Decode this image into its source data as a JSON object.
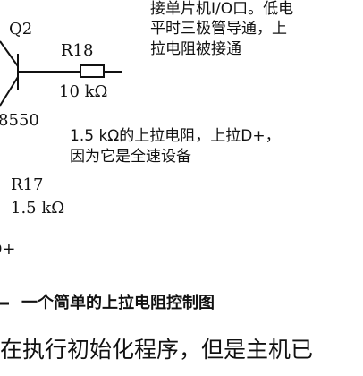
{
  "figure": {
    "labels": {
      "transistor": "Q2",
      "transistor_part": "8550",
      "resistor_r18": "R18",
      "resistor_r18_value": "10 kΩ",
      "resistor_r17": "R17",
      "resistor_r17_value": "1.5 kΩ",
      "dplus_fragment": "D+"
    },
    "annotations": {
      "top_note": [
        "接单片机I/O口。低电",
        "平时三极管导通，上",
        "拉电阻被接通"
      ],
      "middle_note": [
        "1.5 kΩ的上拉电阻，上拉D+，",
        "因为它是全速设备"
      ]
    },
    "caption": "一个简单的上拉电阻控制图"
  },
  "body": {
    "partial_line": "在执行初始化程序，但是主机已"
  }
}
